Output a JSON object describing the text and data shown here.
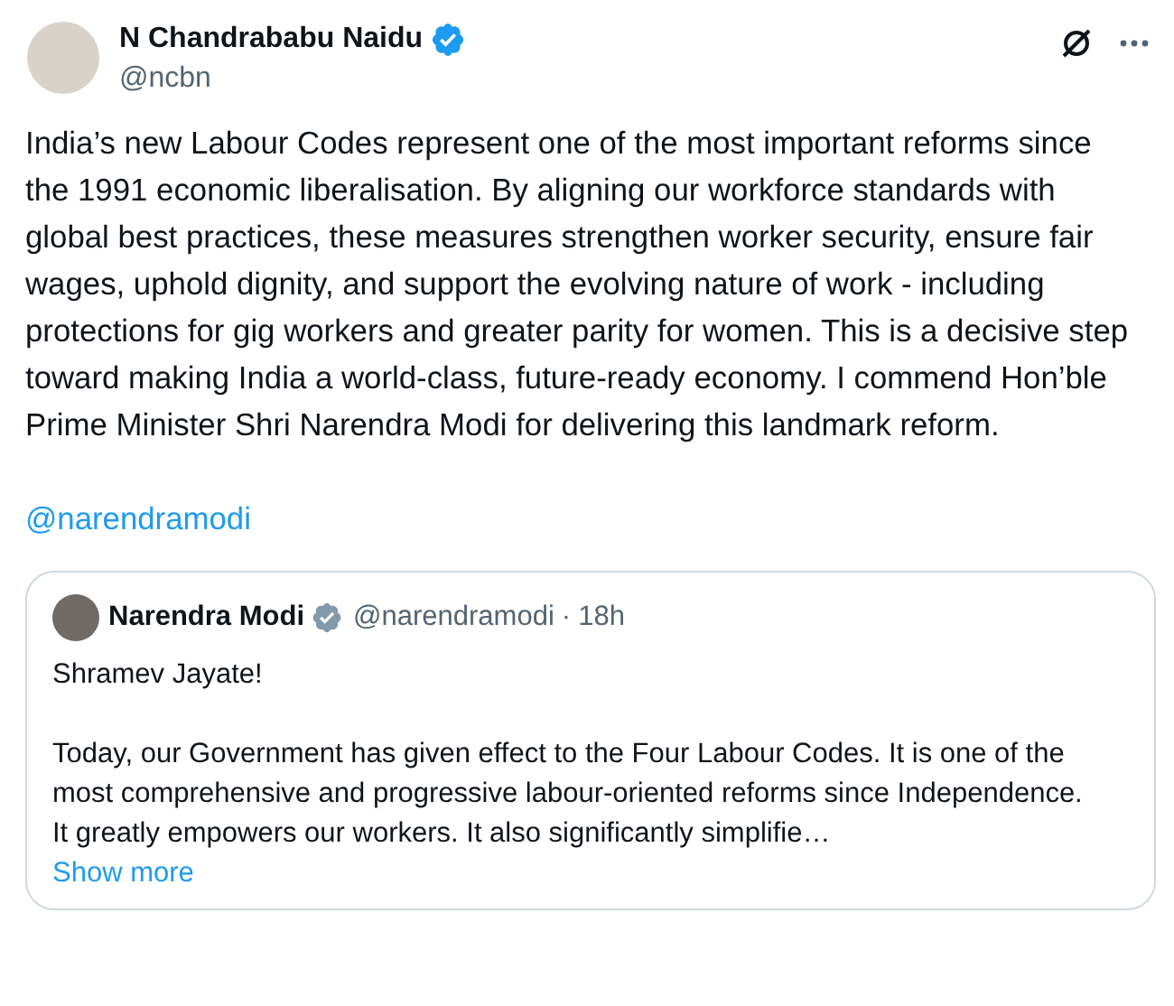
{
  "post": {
    "author": {
      "name": "N Chandrababu Naidu",
      "handle": "@ncbn",
      "verified": true,
      "color": "#1d9bf0"
    },
    "text": "India’s new Labour Codes represent one of the most important reforms since the 1991 economic liberalisation. By aligning our workforce standards with global best practices, these measures strengthen worker security, ensure fair wages, uphold dignity, and support the evolving nature of work - including protections for gig workers and greater parity for women. This is a decisive step toward making India a world-class, future-ready economy. I commend Hon’ble Prime Minister Shri Narendra Modi for delivering this landmark reform.",
    "mention": "@narendramodi",
    "quote": {
      "author": {
        "name": "Narendra Modi",
        "handle": "@narendramodi",
        "verified": true,
        "color": "#829aab"
      },
      "separator": "·",
      "time": "18h",
      "paragraphs": [
        "Shramev Jayate!",
        "Today, our Government has given effect to the Four Labour Codes. It is one of the most comprehensive and progressive labour-oriented reforms since Independence. It greatly empowers our workers. It also significantly simplifie…"
      ],
      "show_more": "Show more"
    }
  }
}
